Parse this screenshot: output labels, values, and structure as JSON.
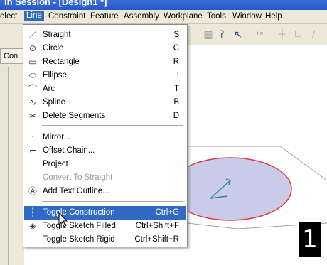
{
  "window": {
    "title": "in Session - [Design1 *]"
  },
  "menubar": {
    "items": [
      {
        "label": "elect"
      },
      {
        "label": "Line"
      },
      {
        "label": "Constraint"
      },
      {
        "label": "Feature"
      },
      {
        "label": "Assembly"
      },
      {
        "label": "Workplane"
      },
      {
        "label": "Tools"
      },
      {
        "label": "Window"
      },
      {
        "label": "Help"
      }
    ]
  },
  "left_panel": {
    "tab_label": "Con"
  },
  "line_menu": {
    "items": [
      {
        "label": "Straight",
        "shortcut": "S",
        "icon": "line-icon"
      },
      {
        "label": "Circle",
        "shortcut": "C",
        "icon": "circle-icon"
      },
      {
        "label": "Rectangle",
        "shortcut": "R",
        "icon": "rectangle-icon"
      },
      {
        "label": "Ellipse",
        "shortcut": "I",
        "icon": "ellipse-icon"
      },
      {
        "label": "Arc",
        "shortcut": "T",
        "icon": "arc-icon"
      },
      {
        "label": "Spline",
        "shortcut": "B",
        "icon": "spline-icon"
      },
      {
        "label": "Delete Segments",
        "shortcut": "D",
        "icon": "scissors-icon"
      },
      {
        "label": "Mirror...",
        "shortcut": "",
        "icon": "mirror-icon"
      },
      {
        "label": "Offset Chain...",
        "shortcut": "",
        "icon": "offset-icon"
      },
      {
        "label": "Project",
        "shortcut": "",
        "icon": ""
      },
      {
        "label": "Convert To Straight",
        "shortcut": "",
        "icon": "",
        "disabled": true
      },
      {
        "label": "Add Text Outline...",
        "shortcut": "",
        "icon": "text-outline-icon"
      },
      {
        "label": "Toggle Construction",
        "shortcut": "Ctrl+G",
        "icon": "construction-icon",
        "highlighted": true
      },
      {
        "label": "Toggle Sketch Filled",
        "shortcut": "Ctrl+Shift+F",
        "icon": "fill-icon"
      },
      {
        "label": "Toggle Sketch Rigid",
        "shortcut": "Ctrl+Shift+R",
        "icon": ""
      }
    ]
  },
  "step_badge": "1",
  "colors": {
    "menu_highlight": "#316ac5",
    "circle_fill": "#c9cbe9",
    "circle_stroke": "#e23c3c",
    "axis_color": "#2a8a98"
  }
}
